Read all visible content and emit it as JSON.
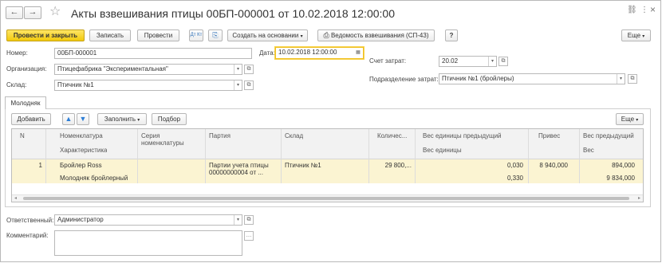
{
  "window": {
    "title": "Акты взвешивания птицы 00БП-000001 от 10.02.2018 12:00:00",
    "nav_back": "←",
    "nav_forward": "→",
    "star": "☆",
    "ctl_link": "⛓",
    "ctl_more": "⋮",
    "ctl_close": "×"
  },
  "toolbar": {
    "post_close": "Провести и закрыть",
    "save": "Записать",
    "post": "Провести",
    "dt_kt": "Дт Кт",
    "structure": "⎘",
    "create_based": "Создать на основании",
    "print": "Ведомость взвешивания (СП-43)",
    "help": "?",
    "more": "Еще"
  },
  "form": {
    "number_label": "Номер:",
    "number_value": "00БП-000001",
    "date_label": "Дата:",
    "date_value": "10.02.2018 12:00:00",
    "org_label": "Организация:",
    "org_value": "Птицефабрика \"Экспериментальная\"",
    "warehouse_label": "Склад:",
    "warehouse_value": "Птичник №1",
    "cost_account_label": "Счет затрат:",
    "cost_account_value": "20.02",
    "cost_dept_label": "Подразделение затрат:",
    "cost_dept_value": "Птичник №1 (бройлеры)",
    "responsible_label": "Ответственный:",
    "responsible_value": "Администратор",
    "comment_label": "Комментарий:",
    "comment_value": ""
  },
  "tab": {
    "label": "Молодняк",
    "add": "Добавить",
    "fill": "Заполнить",
    "select": "Подбор",
    "more": "Еще"
  },
  "table": {
    "headers": {
      "n": "N",
      "nomenclature": "Номенклатура",
      "characteristic": "Характеристика",
      "series": "Серия номенклатуры",
      "batch": "Партия",
      "warehouse": "Склад",
      "quantity": "Количес...",
      "unit_weight_prev": "Вес единицы предыдущий",
      "unit_weight": "Вес единицы",
      "gain": "Привес",
      "weight_prev": "Вес предыдущий",
      "weight": "Вес"
    },
    "rows": [
      {
        "n": "1",
        "nomenclature": "Бройлер Ross",
        "characteristic": "Молодняк бройлерный",
        "series": "",
        "batch": "Партии учета птицы 00000000004 от ...",
        "warehouse": "Птичник №1",
        "quantity": "29 800,...",
        "unit_weight_prev": "0,030",
        "unit_weight": "0,330",
        "gain": "8 940,000",
        "weight_prev": "894,000",
        "weight": "9 834,000"
      }
    ]
  },
  "colors": {
    "primary_button": "#f2c90b",
    "selected_row": "#fbf4d2",
    "focus_border": "#f0c020",
    "arrow_blue": "#2d7ed6"
  }
}
